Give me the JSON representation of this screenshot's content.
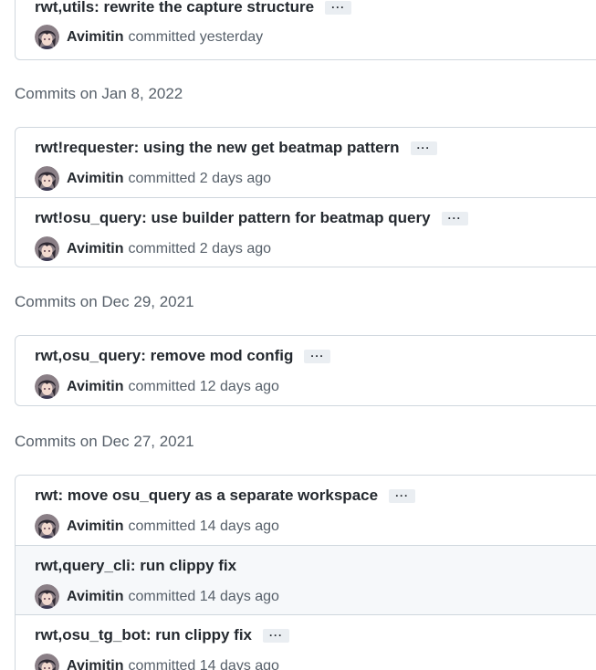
{
  "groups": [
    {
      "header": "",
      "commits": [
        {
          "message": "rwt,utils: rewrite the capture structure",
          "author": "Avimitin",
          "committed": "committed yesterday",
          "has_more": true,
          "highlight": false
        }
      ]
    },
    {
      "header": "Commits on Jan 8, 2022",
      "commits": [
        {
          "message": "rwt!requester: using the new get beatmap pattern",
          "author": "Avimitin",
          "committed": "committed 2 days ago",
          "has_more": true,
          "highlight": false
        },
        {
          "message": "rwt!osu_query: use builder pattern for beatmap query",
          "author": "Avimitin",
          "committed": "committed 2 days ago",
          "has_more": true,
          "highlight": false
        }
      ]
    },
    {
      "header": "Commits on Dec 29, 2021",
      "commits": [
        {
          "message": "rwt,osu_query: remove mod config",
          "author": "Avimitin",
          "committed": "committed 12 days ago",
          "has_more": true,
          "highlight": false
        }
      ]
    },
    {
      "header": "Commits on Dec 27, 2021",
      "commits": [
        {
          "message": "rwt: move osu_query as a separate workspace",
          "author": "Avimitin",
          "committed": "committed 14 days ago",
          "has_more": true,
          "highlight": false
        },
        {
          "message": "rwt,query_cli: run clippy fix",
          "author": "Avimitin",
          "committed": "committed 14 days ago",
          "has_more": false,
          "highlight": true
        },
        {
          "message": "rwt,osu_tg_bot: run clippy fix",
          "author": "Avimitin",
          "committed": "committed 14 days ago",
          "has_more": true,
          "highlight": false
        }
      ]
    }
  ],
  "ellipsis_label": "···",
  "colors": {
    "border": "#d0d7de",
    "muted_text": "#57606a",
    "highlight_row": "#f6f8fa",
    "ellipsis_bg": "#eaeef2"
  },
  "icons": {
    "avatar": "user-avatar-icon"
  }
}
